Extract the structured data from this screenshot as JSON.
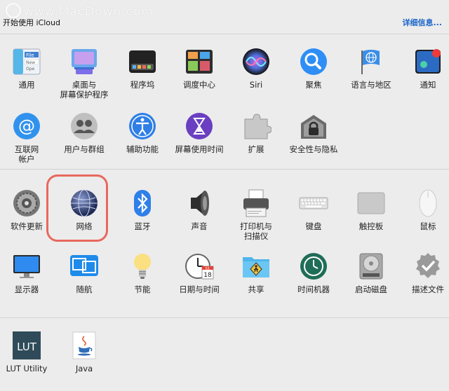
{
  "watermark": "www.MacDown.com",
  "header": {
    "left_text": "开始使用 iCloud",
    "right_link": "详细信息..."
  },
  "section1": [
    {
      "id": "general",
      "label": "通用",
      "icon": "general-icon"
    },
    {
      "id": "desktop",
      "label": "桌面与\n屏幕保护程序",
      "icon": "desktop-screensaver-icon"
    },
    {
      "id": "dock",
      "label": "程序坞",
      "icon": "dock-icon"
    },
    {
      "id": "mission",
      "label": "调度中心",
      "icon": "mission-control-icon"
    },
    {
      "id": "siri",
      "label": "Siri",
      "icon": "siri-icon"
    },
    {
      "id": "spotlight",
      "label": "聚焦",
      "icon": "spotlight-icon"
    },
    {
      "id": "language",
      "label": "语言与地区",
      "icon": "language-region-icon"
    },
    {
      "id": "notify",
      "label": "通知",
      "icon": "notifications-icon"
    },
    {
      "id": "internet",
      "label": "互联网\n帐户",
      "icon": "internet-accounts-icon"
    },
    {
      "id": "users",
      "label": "用户与群组",
      "icon": "users-groups-icon"
    },
    {
      "id": "access",
      "label": "辅助功能",
      "icon": "accessibility-icon"
    },
    {
      "id": "screentime",
      "label": "屏幕使用时间",
      "icon": "screen-time-icon"
    },
    {
      "id": "extensions",
      "label": "扩展",
      "icon": "extensions-icon"
    },
    {
      "id": "security",
      "label": "安全性与隐私",
      "icon": "security-privacy-icon"
    }
  ],
  "section2": [
    {
      "id": "swupdate",
      "label": "软件更新",
      "icon": "software-update-icon"
    },
    {
      "id": "network",
      "label": "网络",
      "icon": "network-icon"
    },
    {
      "id": "bluetooth",
      "label": "蓝牙",
      "icon": "bluetooth-icon"
    },
    {
      "id": "sound",
      "label": "声音",
      "icon": "sound-icon"
    },
    {
      "id": "printers",
      "label": "打印机与\n扫描仪",
      "icon": "printers-scanners-icon"
    },
    {
      "id": "keyboard",
      "label": "键盘",
      "icon": "keyboard-icon"
    },
    {
      "id": "trackpad",
      "label": "触控板",
      "icon": "trackpad-icon"
    },
    {
      "id": "mouse",
      "label": "鼠标",
      "icon": "mouse-icon"
    },
    {
      "id": "displays",
      "label": "显示器",
      "icon": "displays-icon"
    },
    {
      "id": "sidecar",
      "label": "随航",
      "icon": "sidecar-icon"
    },
    {
      "id": "energy",
      "label": "节能",
      "icon": "energy-saver-icon"
    },
    {
      "id": "datetime",
      "label": "日期与时间",
      "icon": "date-time-icon"
    },
    {
      "id": "sharing",
      "label": "共享",
      "icon": "sharing-icon"
    },
    {
      "id": "timemachine",
      "label": "时间机器",
      "icon": "time-machine-icon"
    },
    {
      "id": "startup",
      "label": "启动磁盘",
      "icon": "startup-disk-icon"
    },
    {
      "id": "profiles",
      "label": "描述文件",
      "icon": "profiles-icon"
    }
  ],
  "section3": [
    {
      "id": "lut",
      "label": "LUT Utility",
      "icon": "lut-utility-icon",
      "icon_text": "LUT"
    },
    {
      "id": "java",
      "label": "Java",
      "icon": "java-icon"
    }
  ],
  "calendar_icon": {
    "month": "JUL",
    "day": "18"
  }
}
